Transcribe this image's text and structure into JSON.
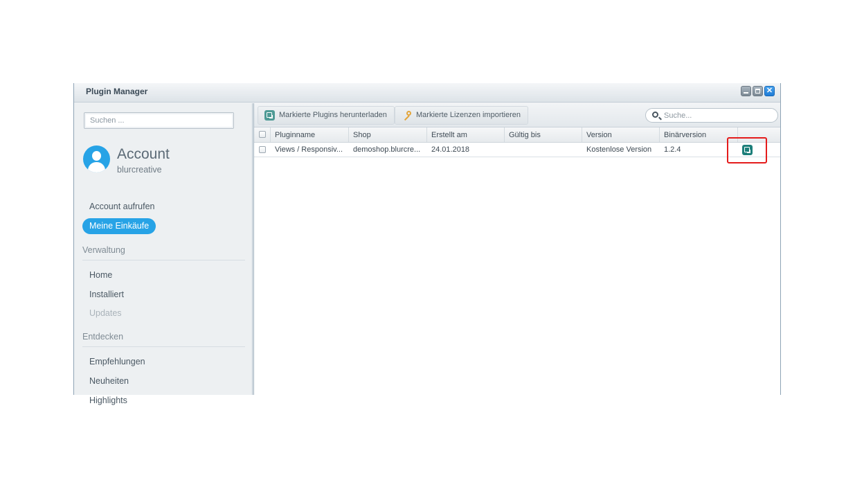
{
  "window": {
    "title": "Plugin Manager"
  },
  "sidebar": {
    "search_placeholder": "Suchen ...",
    "account": {
      "title": "Account",
      "username": "blurcreative",
      "link_open": "Account aufrufen",
      "purchases": "Meine Einkäufe"
    },
    "sections": [
      {
        "title": "Verwaltung",
        "items": [
          "Home",
          "Installiert",
          "Updates"
        ]
      },
      {
        "title": "Entdecken",
        "items": [
          "Empfehlungen",
          "Neuheiten",
          "Highlights"
        ]
      }
    ]
  },
  "toolbar": {
    "download_label": "Markierte Plugins herunterladen",
    "import_label": "Markierte Lizenzen importieren",
    "search_placeholder": "Suche..."
  },
  "grid": {
    "columns": [
      "Pluginname",
      "Shop",
      "Erstellt am",
      "Gültig bis",
      "Version",
      "Binärversion"
    ],
    "rows": [
      {
        "name": "Views / Responsiv...",
        "shop": "demoshop.blurcre...",
        "created": "24.01.2018",
        "valid_until": "",
        "version": "Kostenlose Version",
        "binary": "1.2.4"
      }
    ]
  },
  "colors": {
    "accent": "#27a3e6",
    "action": "#1d7f7a",
    "highlight": "#e41b1b"
  }
}
